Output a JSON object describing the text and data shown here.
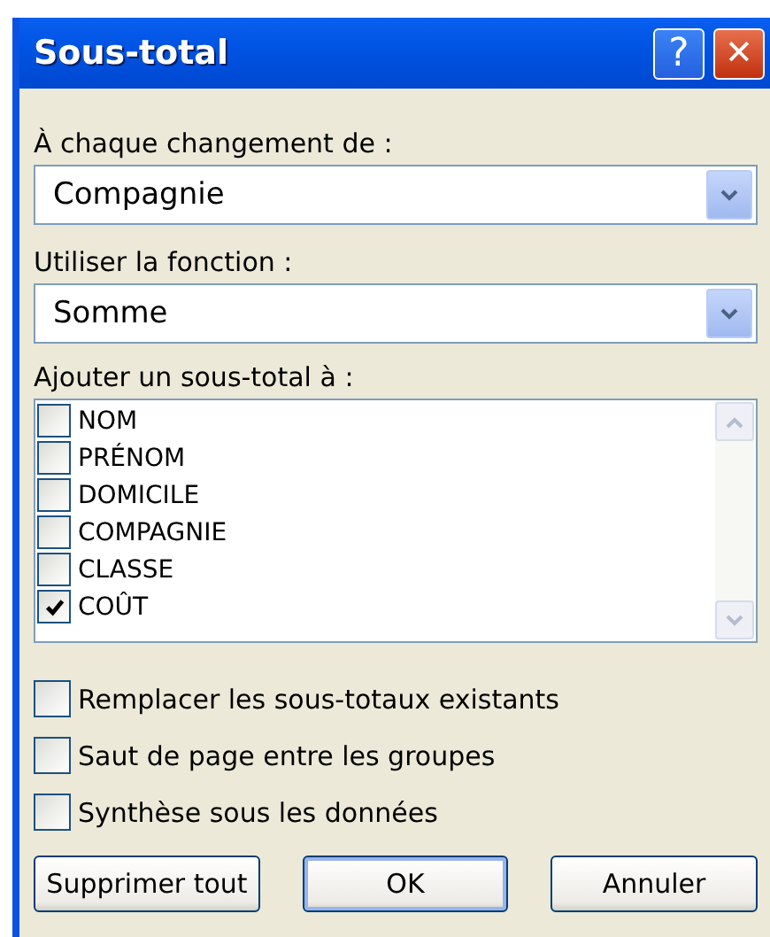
{
  "window": {
    "title": "Sous-total",
    "title_buttons": [
      {
        "kind": "help",
        "label": "?"
      },
      {
        "kind": "close",
        "label": "✕"
      }
    ]
  },
  "group_by": {
    "label": "À chaque changement de :",
    "value": "Compagnie"
  },
  "function": {
    "label": "Utiliser la fonction :",
    "value": "Somme"
  },
  "subtotal_list": {
    "label": "Ajouter un sous-total à :",
    "items": [
      {
        "label": "NOM",
        "checked": false
      },
      {
        "label": "PRÉNOM",
        "checked": false
      },
      {
        "label": "DOMICILE",
        "checked": false
      },
      {
        "label": "COMPAGNIE",
        "checked": false
      },
      {
        "label": "CLASSE",
        "checked": false
      },
      {
        "label": "COÛT",
        "checked": true
      }
    ]
  },
  "options": [
    {
      "label": "Remplacer les sous-totaux existants",
      "checked": false
    },
    {
      "label": "Saut de page entre les groupes",
      "checked": false
    },
    {
      "label": "Synthèse sous les données",
      "checked": false
    }
  ],
  "buttons": [
    {
      "label": "Supprimer tout",
      "default": false
    },
    {
      "label": "OK",
      "default": true
    },
    {
      "label": "Annuler",
      "default": false
    }
  ]
}
